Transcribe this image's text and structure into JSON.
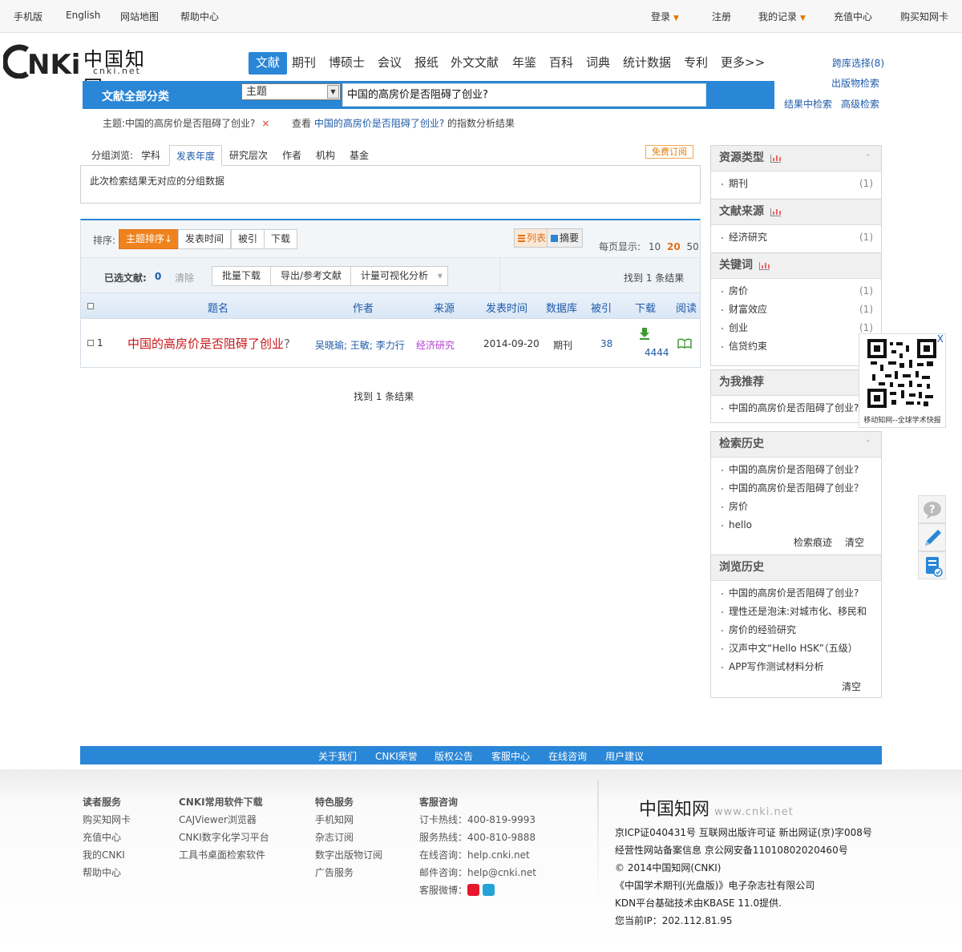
{
  "topbar": {
    "left": [
      "手机版",
      "English",
      "网站地图",
      "帮助中心"
    ],
    "right": [
      "登录",
      "注册",
      "我的记录",
      "充值中心",
      "购买知网卡"
    ]
  },
  "logo": {
    "text": "中国知网",
    "en": "cnki.net"
  },
  "nav": {
    "tabs": [
      "文献",
      "期刊",
      "博硕士",
      "会议",
      "报纸",
      "外文文献",
      "年鉴",
      "百科",
      "词典",
      "统计数据",
      "专利",
      "更多>>"
    ],
    "cross": "跨库选择(8)",
    "pub_search": "出版物检索",
    "in_result": "结果中检索",
    "advanced": "高级检索"
  },
  "search": {
    "category": "文献全部分类",
    "field": "主题",
    "query": "中国的高房价是否阻碍了创业?"
  },
  "crumb": {
    "topic": "主题:中国的高房价是否阻碍了创业?",
    "close": "×",
    "prefix": "查看",
    "term": "中国的高房价是否阻碍了创业?",
    "suffix": "的指数分析结果"
  },
  "group": {
    "label": "分组浏览:",
    "tabs": [
      "学科",
      "发表年度",
      "研究层次",
      "作者",
      "机构",
      "基金"
    ],
    "free": "免费订阅",
    "empty": "此次检索结果无对应的分组数据"
  },
  "sort": {
    "label": "排序:",
    "options": [
      "主题排序",
      "发表时间",
      "被引",
      "下载"
    ],
    "view_list": "列表",
    "view_abstract": "摘要",
    "perpage_label": "每页显示:",
    "perpage": [
      "10",
      "20",
      "50"
    ]
  },
  "selection": {
    "label": "已选文献:",
    "count": "0",
    "clear": "清除",
    "batch_download": "批量下载",
    "export": "导出/参考文献",
    "visualize": "计量可视化分析",
    "found": "找到 1 条结果"
  },
  "table": {
    "headers": [
      "题名",
      "作者",
      "来源",
      "发表时间",
      "数据库",
      "被引",
      "下载",
      "阅读"
    ],
    "rows": [
      {
        "index": "1",
        "title": "中国的高房价是否阻碍了创业",
        "title_suffix": "?",
        "authors": "吴晓瑜; 王敏; 李力行",
        "source": "经济研究",
        "date": "2014-09-20",
        "db": "期刊",
        "cited": "38",
        "downloads": "4444"
      }
    ]
  },
  "found_bottom": "找到 1 条结果",
  "sidebar": {
    "resource_type": {
      "title": "资源类型",
      "items": [
        {
          "label": "期刊",
          "count": "(1)"
        }
      ]
    },
    "source": {
      "title": "文献来源",
      "items": [
        {
          "label": "经济研究",
          "count": "(1)"
        }
      ]
    },
    "keywords": {
      "title": "关键词",
      "items": [
        {
          "label": "房价",
          "count": "(1)"
        },
        {
          "label": "财富效应",
          "count": "(1)"
        },
        {
          "label": "创业",
          "count": "(1)"
        },
        {
          "label": "信贷约束",
          "count": ""
        }
      ]
    },
    "recommend": {
      "title": "为我推荐",
      "items": [
        "中国的高房价是否阻碍了创业?"
      ]
    },
    "search_history": {
      "title": "检索历史",
      "items": [
        "中国的高房价是否阻碍了创业?",
        "中国的高房价是否阻碍了创业？",
        "房价",
        "hello"
      ],
      "trace": "检索痕迹",
      "clear": "清空"
    },
    "browse_history": {
      "title": "浏览历史",
      "items": [
        "中国的高房价是否阻碍了创业?",
        "理性还是泡沫:对城市化、移民和",
        "房价的经验研究",
        "汉声中文“Hello HSK”（五级）",
        "APP写作测试材料分析"
      ],
      "clear": "清空"
    }
  },
  "qr": {
    "close": "X",
    "caption": "移动知网--全球学术快报"
  },
  "footbar": [
    "关于我们",
    "CNKI荣誉",
    "版权公告",
    "客服中心",
    "在线咨询",
    "用户建议"
  ],
  "footer": {
    "reader": {
      "title": "读者服务",
      "items": [
        "购买知网卡",
        "充值中心",
        "我的CNKI",
        "帮助中心"
      ]
    },
    "software": {
      "title": "CNKI常用软件下载",
      "items": [
        "CAJViewer浏览器",
        "CNKI数字化学习平台",
        "工具书桌面检索软件"
      ]
    },
    "special": {
      "title": "特色服务",
      "items": [
        "手机知网",
        "杂志订阅",
        "数字出版物订阅",
        "广告服务"
      ]
    },
    "support": {
      "title": "客服咨询",
      "items": [
        "订卡热线：400-819-9993",
        "服务热线：400-810-9888",
        "在线咨询：help.cnki.net",
        "邮件咨询：help@cnki.net",
        "客服微博："
      ]
    },
    "logo": "中国知网",
    "logo_url": "www.cnki.net",
    "info": [
      "京ICP证040431号 互联网出版许可证 新出网证(京)字008号",
      "经营性网站备案信息 京公网安备11010802020460号",
      "© 2014中国知网(CNKI)",
      "《中国学术期刊(光盘版)》电子杂志社有限公司",
      "KDN平台基础技术由KBASE 11.0提供.",
      "您当前IP：202.112.81.95"
    ]
  },
  "colors": {
    "primary": "#2a86d6",
    "accent": "#f0821e",
    "link": "#1e5aa8",
    "title_red": "#c8171b",
    "source_purple": "#b23bd3"
  }
}
